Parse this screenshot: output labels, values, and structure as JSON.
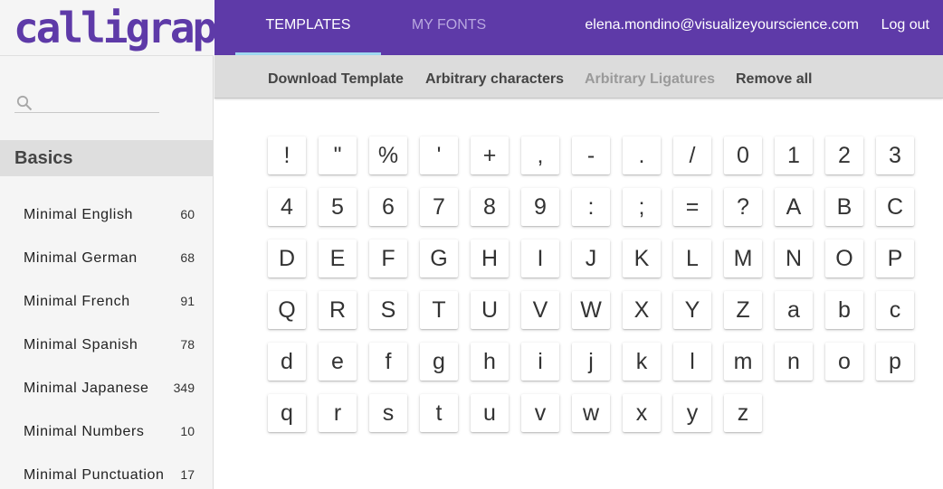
{
  "app": {
    "logo_text": "calligraphr",
    "brand_color": "#5e3aa8"
  },
  "nav": {
    "tabs": [
      {
        "label": "TEMPLATES",
        "active": true
      },
      {
        "label": "MY FONTS",
        "active": false
      }
    ],
    "user_email": "elena.mondino@visualizeyourscience.com",
    "logout_label": "Log out"
  },
  "toolbar": {
    "download_template": "Download Template",
    "arbitrary_characters": "Arbitrary characters",
    "arbitrary_ligatures": "Arbitrary Ligatures",
    "remove_all": "Remove all"
  },
  "sidebar": {
    "search_icon": "search-icon",
    "section_title": "Basics",
    "templates": [
      {
        "name": "Minimal English",
        "count": "60"
      },
      {
        "name": "Minimal German",
        "count": "68"
      },
      {
        "name": "Minimal French",
        "count": "91"
      },
      {
        "name": "Minimal Spanish",
        "count": "78"
      },
      {
        "name": "Minimal Japanese",
        "count": "349"
      },
      {
        "name": "Minimal Numbers",
        "count": "10"
      },
      {
        "name": "Minimal Punctuation",
        "count": "17"
      }
    ]
  },
  "characters": [
    "!",
    "\"",
    "%",
    "'",
    "+",
    ",",
    "-",
    ".",
    "/",
    "0",
    "1",
    "2",
    "3",
    "4",
    "5",
    "6",
    "7",
    "8",
    "9",
    ":",
    ";",
    "=",
    "?",
    "A",
    "B",
    "C",
    "D",
    "E",
    "F",
    "G",
    "H",
    "I",
    "J",
    "K",
    "L",
    "M",
    "N",
    "O",
    "P",
    "Q",
    "R",
    "S",
    "T",
    "U",
    "V",
    "W",
    "X",
    "Y",
    "Z",
    "a",
    "b",
    "c",
    "d",
    "e",
    "f",
    "g",
    "h",
    "i",
    "j",
    "k",
    "l",
    "m",
    "n",
    "o",
    "p",
    "q",
    "r",
    "s",
    "t",
    "u",
    "v",
    "w",
    "x",
    "y",
    "z"
  ]
}
